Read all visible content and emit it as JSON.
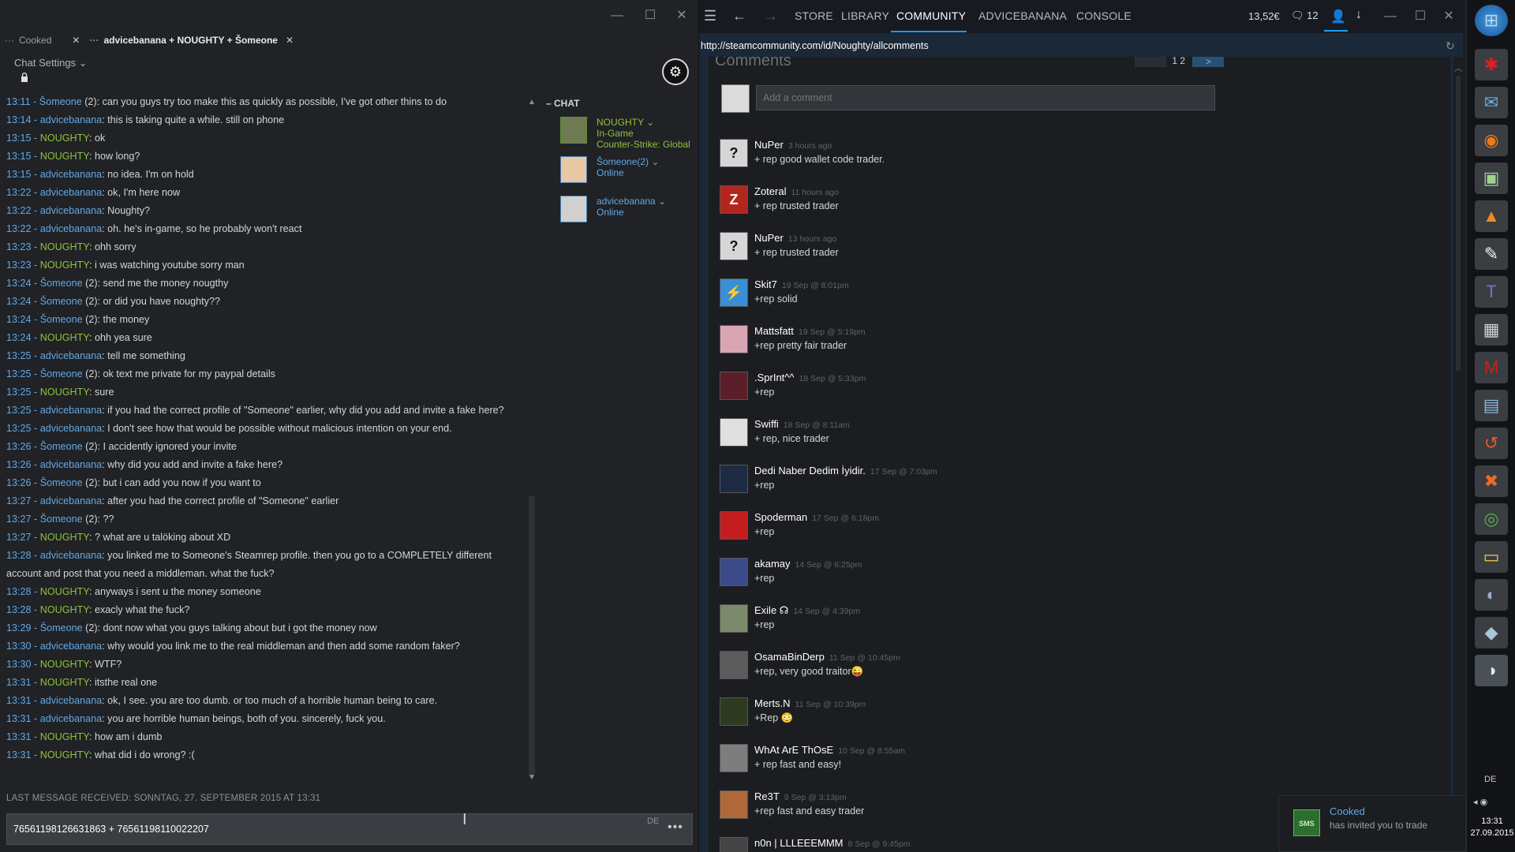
{
  "chat": {
    "tabs": [
      {
        "label": "Cooked"
      },
      {
        "label": "advicebanana + NOUGHTY + Šomeone"
      }
    ],
    "settings_label": "Chat Settings",
    "messages": [
      {
        "time": "13:11",
        "name": "Šomeone",
        "suffix": " (2)",
        "role": "som",
        "text": ": can you guys try too make this as quickly as possible, I've got other thins to do"
      },
      {
        "time": "13:14",
        "name": "advicebanana",
        "suffix": "",
        "role": "adv",
        "text": ": this is taking quite a while. still on phone"
      },
      {
        "time": "13:15",
        "name": "NOUGHTY",
        "suffix": "",
        "role": "nou",
        "text": ": ok"
      },
      {
        "time": "13:15",
        "name": "NOUGHTY",
        "suffix": "",
        "role": "nou",
        "text": ": how long?"
      },
      {
        "time": "13:15",
        "name": "advicebanana",
        "suffix": "",
        "role": "adv",
        "text": ": no idea. I'm on hold"
      },
      {
        "time": "13:22",
        "name": "advicebanana",
        "suffix": "",
        "role": "adv",
        "text": ": ok, I'm here now"
      },
      {
        "time": "13:22",
        "name": "advicebanana",
        "suffix": "",
        "role": "adv",
        "text": ": Noughty?"
      },
      {
        "time": "13:22",
        "name": "advicebanana",
        "suffix": "",
        "role": "adv",
        "text": ": oh. he's in-game, so he probably won't react"
      },
      {
        "time": "13:23",
        "name": "NOUGHTY",
        "suffix": "",
        "role": "nou",
        "text": ": ohh sorry"
      },
      {
        "time": "13:23",
        "name": "NOUGHTY",
        "suffix": "",
        "role": "nou",
        "text": ": i was watching youtube sorry man"
      },
      {
        "time": "13:24",
        "name": "Šomeone",
        "suffix": " (2)",
        "role": "som",
        "text": ": send me the money nougthy"
      },
      {
        "time": "13:24",
        "name": "Šomeone",
        "suffix": " (2)",
        "role": "som",
        "text": ": or did you have noughty??"
      },
      {
        "time": "13:24",
        "name": "Šomeone",
        "suffix": " (2)",
        "role": "som",
        "text": ": the money"
      },
      {
        "time": "13:24",
        "name": "NOUGHTY",
        "suffix": "",
        "role": "nou",
        "text": ": ohh yea sure"
      },
      {
        "time": "13:25",
        "name": "advicebanana",
        "suffix": "",
        "role": "adv",
        "text": ": tell me something"
      },
      {
        "time": "13:25",
        "name": "Šomeone",
        "suffix": " (2)",
        "role": "som",
        "text": ": ok text me private for my paypal details"
      },
      {
        "time": "13:25",
        "name": "NOUGHTY",
        "suffix": "",
        "role": "nou",
        "text": ": sure"
      },
      {
        "time": "13:25",
        "name": "advicebanana",
        "suffix": "",
        "role": "adv",
        "text": ": if you had the correct profile of \"Someone\" earlier, why did you add and invite a fake here?"
      },
      {
        "time": "13:25",
        "name": "advicebanana",
        "suffix": "",
        "role": "adv",
        "text": ": I don't see how that would be possible without malicious intention on your end."
      },
      {
        "time": "13:26",
        "name": "Šomeone",
        "suffix": " (2)",
        "role": "som",
        "text": ": I accidently ignored your invite"
      },
      {
        "time": "13:26",
        "name": "advicebanana",
        "suffix": "",
        "role": "adv",
        "text": ": why did you add and invite a fake here?"
      },
      {
        "time": "13:26",
        "name": "Šomeone",
        "suffix": " (2)",
        "role": "som",
        "text": ": but i can add you now if you want to"
      },
      {
        "time": "13:27",
        "name": "advicebanana",
        "suffix": "",
        "role": "adv",
        "text": ": after you had the correct profile of \"Someone\" earlier"
      },
      {
        "time": "13:27",
        "name": "Šomeone",
        "suffix": " (2)",
        "role": "som",
        "text": ": ??"
      },
      {
        "time": "13:27",
        "name": "NOUGHTY",
        "suffix": "",
        "role": "nou",
        "text": ": ? what are u talöking about XD"
      },
      {
        "time": "13:28",
        "name": "advicebanana",
        "suffix": "",
        "role": "adv",
        "text": ": you linked me to Someone's Steamrep profile. then you go to a COMPLETELY different account and post that you need a middleman. what the fuck?"
      },
      {
        "time": "13:28",
        "name": "NOUGHTY",
        "suffix": "",
        "role": "nou",
        "text": ": anyways i sent u the money someone"
      },
      {
        "time": "13:28",
        "name": "NOUGHTY",
        "suffix": "",
        "role": "nou",
        "text": ": exacly what the fuck?"
      },
      {
        "time": "13:29",
        "name": "Šomeone",
        "suffix": " (2)",
        "role": "som",
        "text": ": dont now what you guys talking about but i got the money now"
      },
      {
        "time": "13:30",
        "name": "advicebanana",
        "suffix": "",
        "role": "adv",
        "text": ": why would you link me to the real middleman and then add some random faker?"
      },
      {
        "time": "13:30",
        "name": "NOUGHTY",
        "suffix": "",
        "role": "nou",
        "text": ": WTF?"
      },
      {
        "time": "13:31",
        "name": "NOUGHTY",
        "suffix": "",
        "role": "nou",
        "text": ": itsthe real one"
      },
      {
        "time": "13:31",
        "name": "advicebanana",
        "suffix": "",
        "role": "adv",
        "text": ": ok, I see. you are too dumb. or too much of a horrible human being to care."
      },
      {
        "time": "13:31",
        "name": "advicebanana",
        "suffix": "",
        "role": "adv",
        "text": ": you are horrible human beings, both of you. sincerely, fuck you."
      },
      {
        "time": "13:31",
        "name": "NOUGHTY",
        "suffix": "",
        "role": "nou",
        "text": ": how am i dumb"
      },
      {
        "time": "13:31",
        "name": "NOUGHTY",
        "suffix": "",
        "role": "nou",
        "text": ": what did i do wrong? :("
      }
    ],
    "last_received": "LAST MESSAGE RECEIVED: SONNTAG, 27. SEPTEMBER 2015 AT 13:31",
    "input_value": "76561198126631863 + 76561198110022207",
    "input_lang": "DE",
    "friends_header": "CHAT",
    "friends": [
      {
        "name": "NOUGHTY",
        "status": "In-Game",
        "game": "Counter-Strike: Global",
        "color": "#8fc23a"
      },
      {
        "name": "Šomeone(2)",
        "status": "Online",
        "game": "",
        "color": "#62a8e5"
      },
      {
        "name": "advicebanana",
        "status": "Online",
        "game": "",
        "color": "#62a8e5"
      }
    ]
  },
  "steam": {
    "nav": [
      "STORE",
      "LIBRARY",
      "COMMUNITY",
      "ADVICEBANANA",
      "CONSOLE"
    ],
    "active_nav": "COMMUNITY",
    "wallet": "13,52€",
    "notifications": "12",
    "url": "http://steamcommunity.com/id/Noughty/allcomments",
    "comments_title": "Comments",
    "pager": "1 2",
    "pager_next": ">",
    "add_comment_placeholder": "Add a comment",
    "comments": [
      {
        "name": "NuPer",
        "time": "3 hours ago",
        "text": "+ rep good wallet code trader.",
        "avatar": "#d6d6d6",
        "glyph": "?"
      },
      {
        "name": "Zoteral",
        "time": "11 hours ago",
        "text": "+ rep trusted trader",
        "avatar": "#b3261e",
        "glyph": "Z"
      },
      {
        "name": "NuPer",
        "time": "13 hours ago",
        "text": "+ rep trusted trader",
        "avatar": "#d6d6d6",
        "glyph": "?"
      },
      {
        "name": "Skit7",
        "time": "19 Sep @ 8:01pm",
        "text": "+rep solid",
        "avatar": "#3a8ed6",
        "glyph": "⚡"
      },
      {
        "name": "Mattsfatt",
        "time": "19 Sep @ 5:19pm",
        "text": "+rep pretty fair trader",
        "avatar": "#d9a5b2",
        "glyph": ""
      },
      {
        "name": ".SprInt^^",
        "time": "18 Sep @ 5:33pm",
        "text": "+rep",
        "avatar": "#5a1f28",
        "glyph": ""
      },
      {
        "name": "Swiffi",
        "time": "18 Sep @ 8:11am",
        "text": "+ rep, nice trader",
        "avatar": "#e0e0e0",
        "glyph": ""
      },
      {
        "name": "Dedi Naber Dedim İyidir.",
        "time": "17 Sep @ 7:03pm",
        "text": "+rep",
        "avatar": "#1d2a44",
        "glyph": ""
      },
      {
        "name": "Spoderman",
        "time": "17 Sep @ 6:18pm",
        "text": "+rep",
        "avatar": "#c41d1d",
        "glyph": ""
      },
      {
        "name": "akamay",
        "time": "14 Sep @ 6:25pm",
        "text": "+rep",
        "avatar": "#3d4a8a",
        "glyph": ""
      },
      {
        "name": "Exile ☊",
        "time": "14 Sep @ 4:39pm",
        "text": "+rep",
        "avatar": "#7a8a6a",
        "glyph": ""
      },
      {
        "name": "OsamaBinDerp",
        "time": "11 Sep @ 10:45pm",
        "text": "+rep, very good traitor😜",
        "avatar": "#5c5c5c",
        "glyph": ""
      },
      {
        "name": "Merts.N",
        "time": "11 Sep @ 10:39pm",
        "text": "+Rep 😳",
        "avatar": "#2e3a22",
        "glyph": ""
      },
      {
        "name": "WhAt ArE ThOsE",
        "time": "10 Sep @ 8:55am",
        "text": "+ rep fast and easy!",
        "avatar": "#7d7d7d",
        "glyph": ""
      },
      {
        "name": "Re3T",
        "time": "9 Sep @ 3:13pm",
        "text": "+rep fast and easy trader",
        "avatar": "#b0683a",
        "glyph": ""
      },
      {
        "name": "n0n | LLLEEEMMM",
        "time": "8 Sep @ 9:45pm",
        "text": "",
        "avatar": "#444",
        "glyph": ""
      }
    ]
  },
  "taskbar": {
    "lang": "DE",
    "time": "13:31",
    "date": "27.09.2015"
  },
  "toast": {
    "name": "Cooked",
    "text": "has invited you to trade",
    "avatar_text": "SMS"
  }
}
